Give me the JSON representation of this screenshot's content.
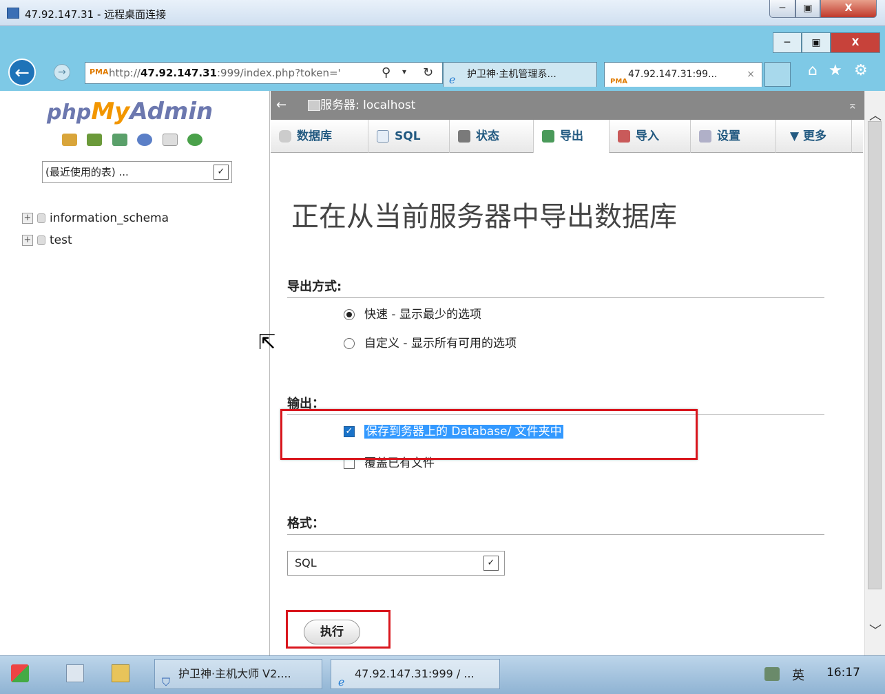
{
  "rdp": {
    "title": "47.92.147.31 - 远程桌面连接",
    "min_label": "─",
    "max_label": "▣",
    "close_label": "X"
  },
  "ie_window": {
    "min_label": "─",
    "max_label": "▣",
    "close_label": "X"
  },
  "nav": {
    "url_prefix": "http://",
    "url_host": "47.92.147.31",
    "url_rest": ":999/index.php?token='",
    "tab1_title": "护卫神·主机管理系...",
    "tab2_title": "47.92.147.31:99...",
    "tab2_close": "×",
    "pma_favicon": "PMA"
  },
  "left": {
    "logo_php": "php",
    "logo_my": "My",
    "logo_admin": "Admin",
    "recent_select": "(最近使用的表) ...",
    "databases": [
      "information_schema",
      "test"
    ]
  },
  "server_bar": {
    "back": "←",
    "title": "服务器: localhost",
    "collapse": "⌅"
  },
  "tabs": {
    "databases": "数据库",
    "sql": "SQL",
    "status": "状态",
    "export": "导出",
    "import": "导入",
    "settings": "设置",
    "more": "▼ 更多"
  },
  "export": {
    "page_title": "正在从当前服务器中导出数据库",
    "method_heading": "导出方式:",
    "option_quick": "快速 - 显示最少的选项",
    "option_custom": "自定义 - 显示所有可用的选项",
    "output_heading": "输出：",
    "save_on_server": "保存到务器上的 Database/ 文件夹中",
    "overwrite": "覆盖已有文件",
    "format_heading": "格式：",
    "format_value": "SQL",
    "go_button": "执行"
  },
  "taskbar": {
    "app1": "护卫神·主机大师 V2....",
    "app2": "47.92.147.31:999 / ...",
    "ime": "英",
    "clock": "16:17"
  },
  "colors": {
    "highlight_box": "#d9161d",
    "ie_chrome": "#7ec9e6",
    "pma_orange": "#f29600",
    "pma_blue": "#6c78af",
    "tab_text": "#235a81"
  }
}
